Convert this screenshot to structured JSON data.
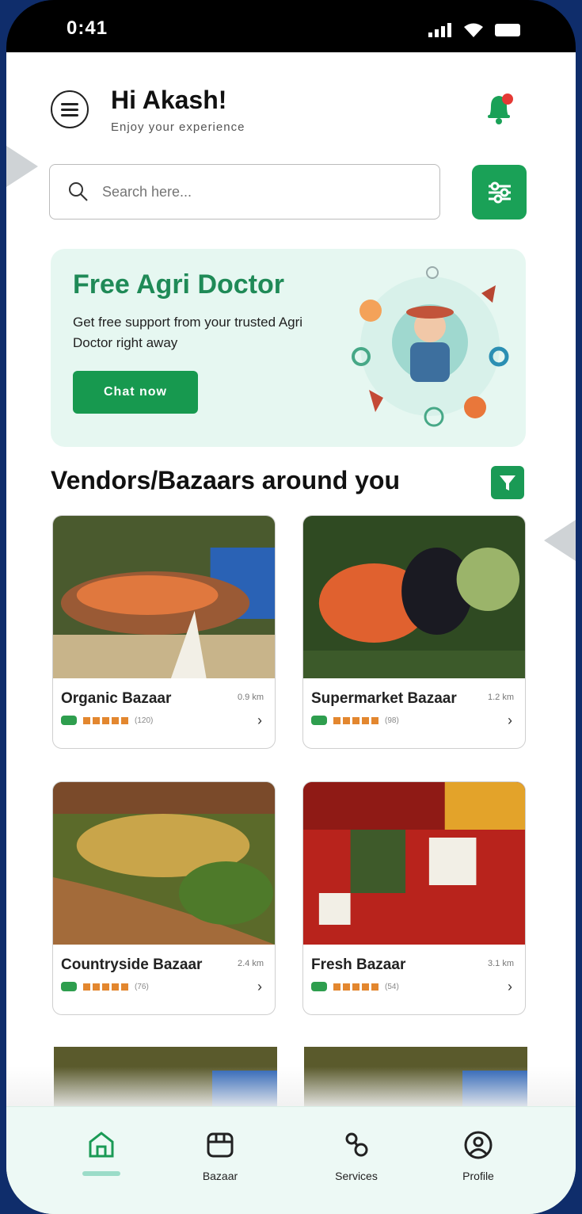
{
  "status": {
    "time": "0:41"
  },
  "header": {
    "greeting": "Hi Akash!",
    "subtitle": "Enjoy your experience"
  },
  "search": {
    "placeholder": "Search here..."
  },
  "banner": {
    "title": "Free Agri Doctor",
    "description": "Get free support from your trusted Agri Doctor right away",
    "button_label": "Chat now"
  },
  "section": {
    "title": "Vendors/Bazaars around you"
  },
  "vendors": [
    {
      "name": "Organic Bazaar",
      "distance": "0.9 km",
      "meta": "(120)"
    },
    {
      "name": "Supermarket Bazaar",
      "distance": "1.2 km",
      "meta": "(98)"
    },
    {
      "name": "Countryside Bazaar",
      "distance": "2.4 km",
      "meta": "(76)"
    },
    {
      "name": "Fresh Bazaar",
      "distance": "3.1 km",
      "meta": "(54)"
    }
  ],
  "nav": {
    "items": [
      {
        "label": "",
        "icon": "home-icon"
      },
      {
        "label": "Bazaar",
        "icon": "store-icon"
      },
      {
        "label": "Services",
        "icon": "services-icon"
      },
      {
        "label": "Profile",
        "icon": "profile-icon"
      }
    ]
  },
  "colors": {
    "primary": "#1aa157",
    "banner_bg": "#e6f7f1",
    "star": "#e3872f",
    "nav_bg": "#edf9f5"
  }
}
